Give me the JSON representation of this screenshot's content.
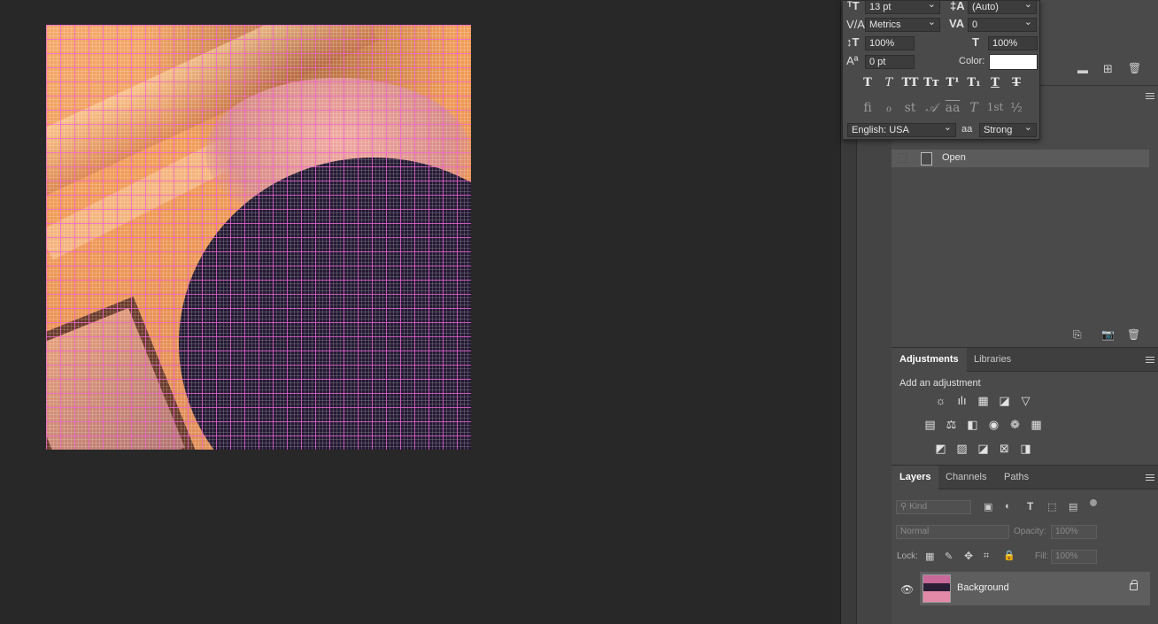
{
  "character_panel": {
    "font_size": "13 pt",
    "leading": "(Auto)",
    "kerning": "Metrics",
    "tracking": "0",
    "vertical_scale": "100%",
    "horizontal_scale": "100%",
    "baseline_shift": "0 pt",
    "color_label": "Color:",
    "color_value": "#ffffff",
    "style_buttons": [
      "T",
      "T",
      "TT",
      "Tт",
      "T¹",
      "T₁",
      "T",
      "T"
    ],
    "opentype_buttons": [
      "fi",
      "ℴ",
      "st",
      "𝒜",
      "aa",
      "T",
      "1st",
      "½"
    ],
    "language": "English: USA",
    "antialias_icon": "aa",
    "antialias": "Strong"
  },
  "history": {
    "items": [
      {
        "label": "Open"
      }
    ]
  },
  "adjustments": {
    "tabs": [
      "Adjustments",
      "Libraries"
    ],
    "title": "Add an adjustment"
  },
  "layers": {
    "tabs": [
      "Layers",
      "Channels",
      "Paths"
    ],
    "filter_placeholder": "Kind",
    "blend_mode": "Normal",
    "opacity_label": "Opacity:",
    "opacity_value": "100%",
    "lock_label": "Lock:",
    "fill_label": "Fill:",
    "fill_value": "100%",
    "layer_name": "Background"
  },
  "colors": {
    "grid": "#ee60d6",
    "panel": "#4a4a4a",
    "workspace": "#282828"
  }
}
